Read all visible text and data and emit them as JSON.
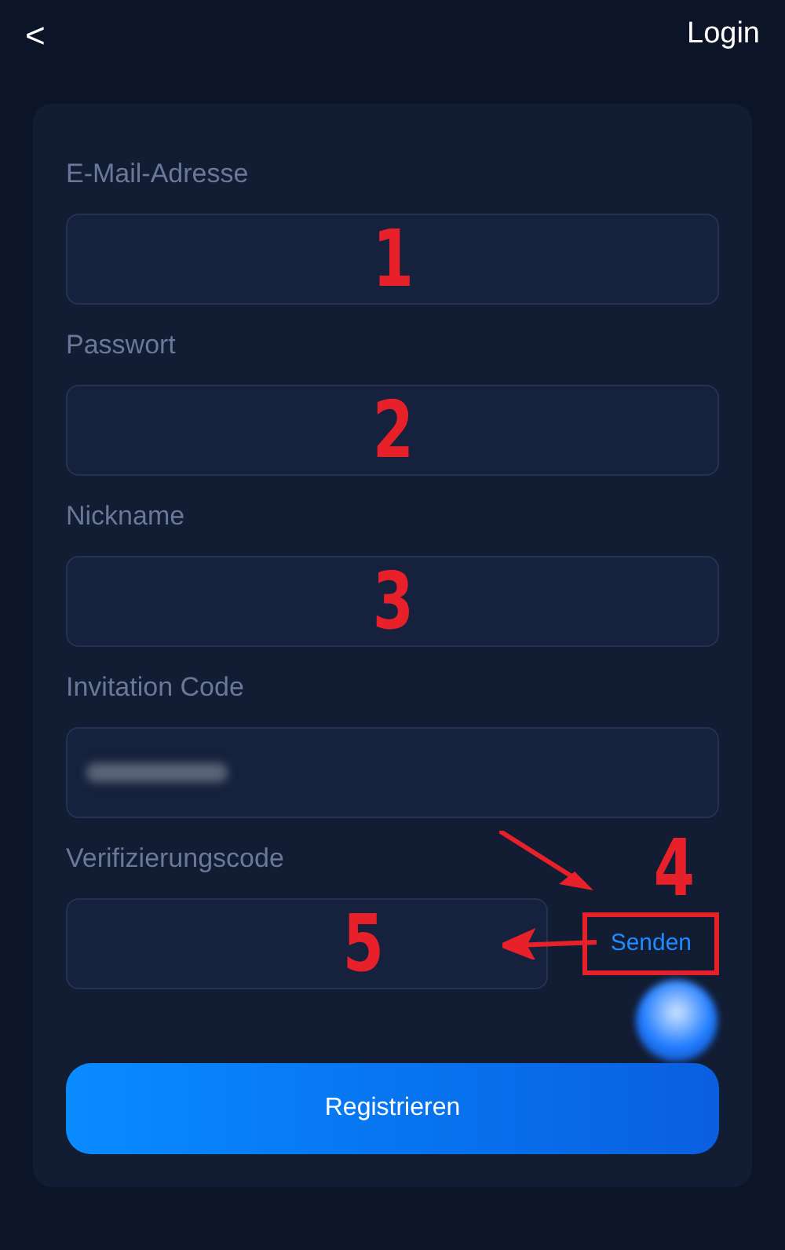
{
  "header": {
    "back": "<",
    "title": "Login"
  },
  "fields": [
    {
      "label": "E-Mail-Adresse",
      "kind": "empty",
      "annotation": "1"
    },
    {
      "label": "Passwort",
      "kind": "empty",
      "annotation": "2"
    },
    {
      "label": "Nickname",
      "kind": "empty",
      "annotation": "3"
    },
    {
      "label": "Invitation Code",
      "kind": "blurred"
    },
    {
      "label": "Verifizierungscode",
      "kind": "code",
      "annotation": "5",
      "send": {
        "label": "Senden",
        "highlighted": true,
        "annotation": "4"
      }
    }
  ],
  "submit": "Registrieren"
}
